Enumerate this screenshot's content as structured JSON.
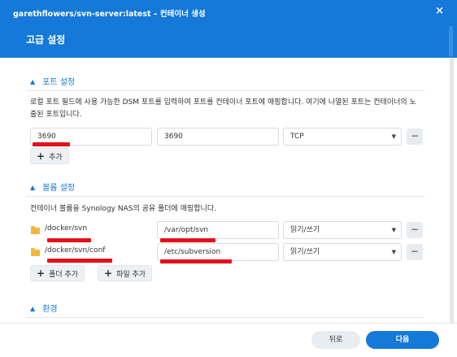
{
  "window": {
    "title": "garethflowers/svn-server:latest – 컨테이너 생성",
    "subtitle": "고급 설정",
    "close_glyph": "×"
  },
  "port_section": {
    "title": "포트 설정",
    "description": "로컬 포트 필드에 사용 가능한 DSM 포트를 입력하여 포트를 컨테이너 포트에 매핑합니다. 여기에 나열된 포트는 컨테이너의 노출된 포트입니다.",
    "rows": [
      {
        "local_port": "3690",
        "container_port": "3690",
        "protocol": "TCP"
      }
    ],
    "add_label": "추가"
  },
  "volume_section": {
    "title": "볼륨 설정",
    "description": "컨테이너 볼륨을 Synology NAS의 공유 폴더에 매핑합니다.",
    "rows": [
      {
        "folder": "/docker/svn",
        "mount_path": "/var/opt/svn",
        "permission": "읽기/쓰기"
      },
      {
        "folder": "/docker/svn/conf",
        "mount_path": "/etc/subversion",
        "permission": "읽기/쓰기"
      }
    ],
    "add_folder_label": "폴더 추가",
    "add_file_label": "파일 추가"
  },
  "env_section": {
    "title": "환경"
  },
  "footer": {
    "back_label": "뒤로",
    "next_label": "다음"
  },
  "icons": {
    "chevron": "chevron-up-icon",
    "plus": "plus-icon",
    "minus": "minus-icon",
    "folder": "folder-icon",
    "dropdown": "caret-down-icon"
  },
  "colors": {
    "accent": "#1479d8",
    "redaction": "#e2101a",
    "folder": "#f4b63c"
  }
}
